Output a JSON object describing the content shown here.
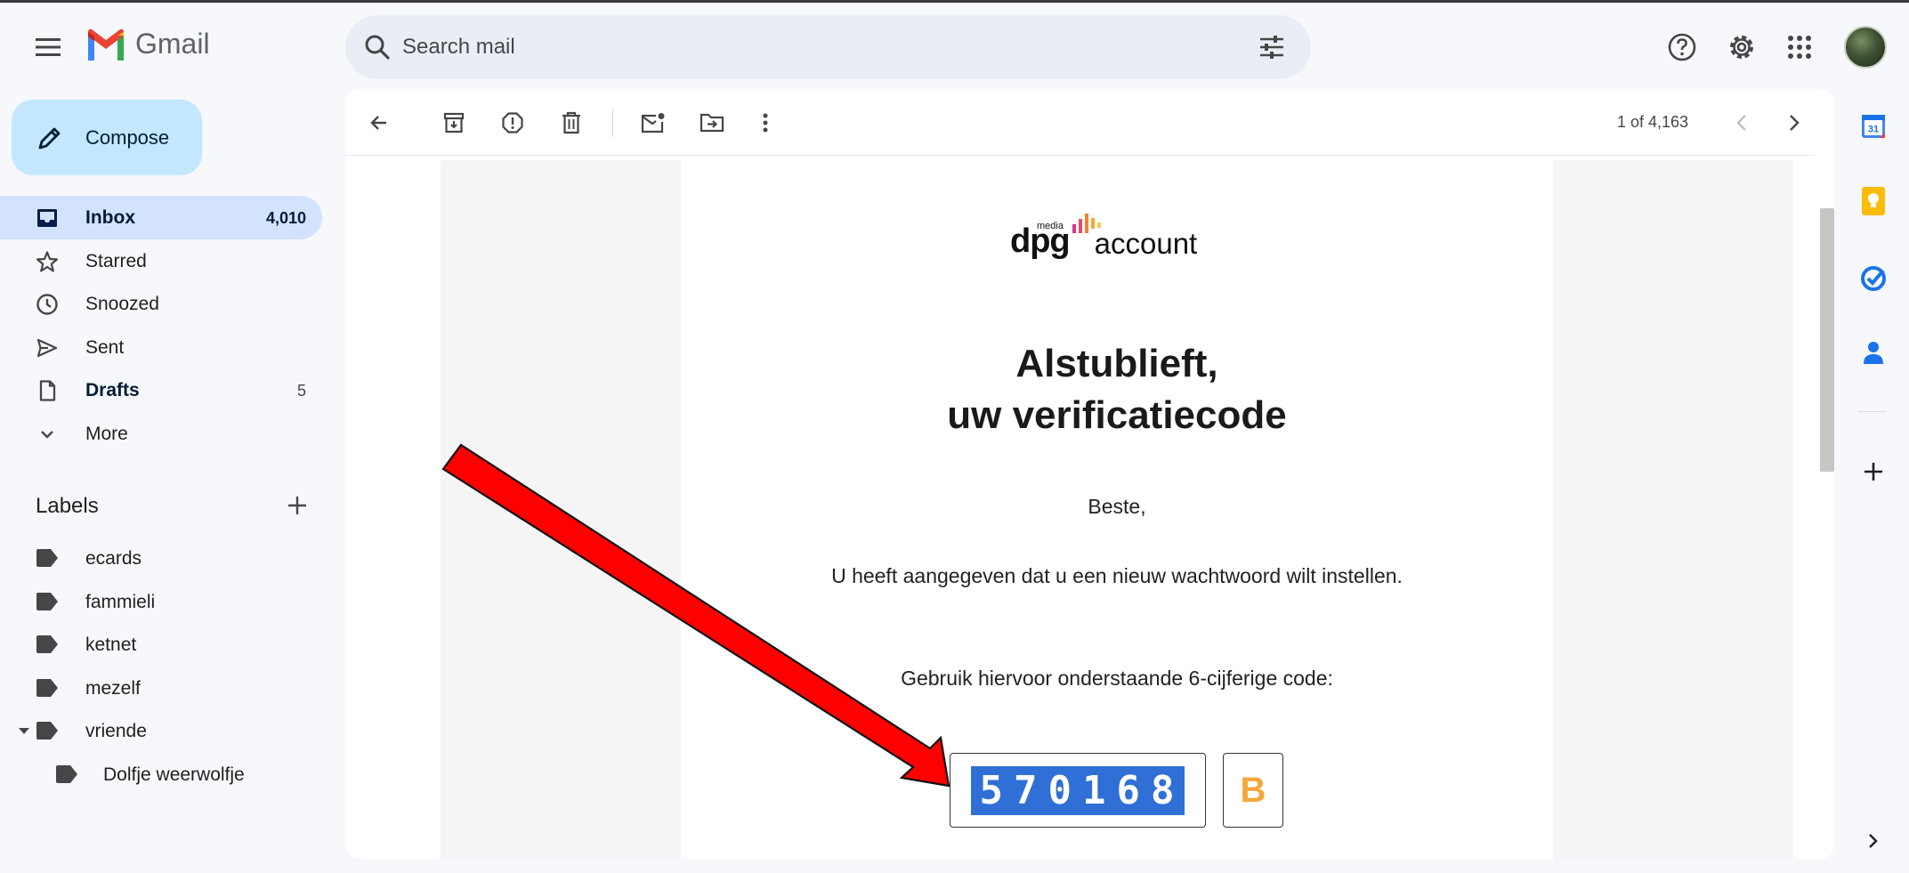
{
  "app": {
    "name": "Gmail"
  },
  "search": {
    "placeholder": "Search mail"
  },
  "compose": {
    "label": "Compose"
  },
  "nav": [
    {
      "label": "Inbox",
      "count": "4,010",
      "icon": "inbox-icon"
    },
    {
      "label": "Starred",
      "count": "",
      "icon": "star-icon"
    },
    {
      "label": "Snoozed",
      "count": "",
      "icon": "clock-icon"
    },
    {
      "label": "Sent",
      "count": "",
      "icon": "send-icon"
    },
    {
      "label": "Drafts",
      "count": "5",
      "icon": "draft-icon"
    },
    {
      "label": "More",
      "count": "",
      "icon": "chevron-down-icon"
    }
  ],
  "labels": {
    "heading": "Labels",
    "items": [
      {
        "label": "ecards"
      },
      {
        "label": "fammieli"
      },
      {
        "label": "ketnet"
      },
      {
        "label": "mezelf"
      },
      {
        "label": "vriende"
      },
      {
        "label": "Dolfje weerwolfje"
      }
    ]
  },
  "toolbar": {
    "page_count": "1 of 4,163"
  },
  "email": {
    "brand_media": "media",
    "brand_dpg": "dpg",
    "brand_account": "account",
    "headline_line1": "Alstublieft,",
    "headline_line2": "uw verificatiecode",
    "greeting": "Beste,",
    "para1": "U heeft aangegeven dat u een nieuw wachtwoord wilt instellen.",
    "para2": "Gebruik hiervoor onderstaande 6-cijferige code:",
    "code": "570168",
    "code_extra": "B"
  },
  "colors": {
    "accent": "#c2e7ff",
    "active_nav": "#d3e3fd",
    "code_highlight": "#2f6fd6",
    "arrow": "#ff0000",
    "code_extra": "#f4a83a"
  }
}
